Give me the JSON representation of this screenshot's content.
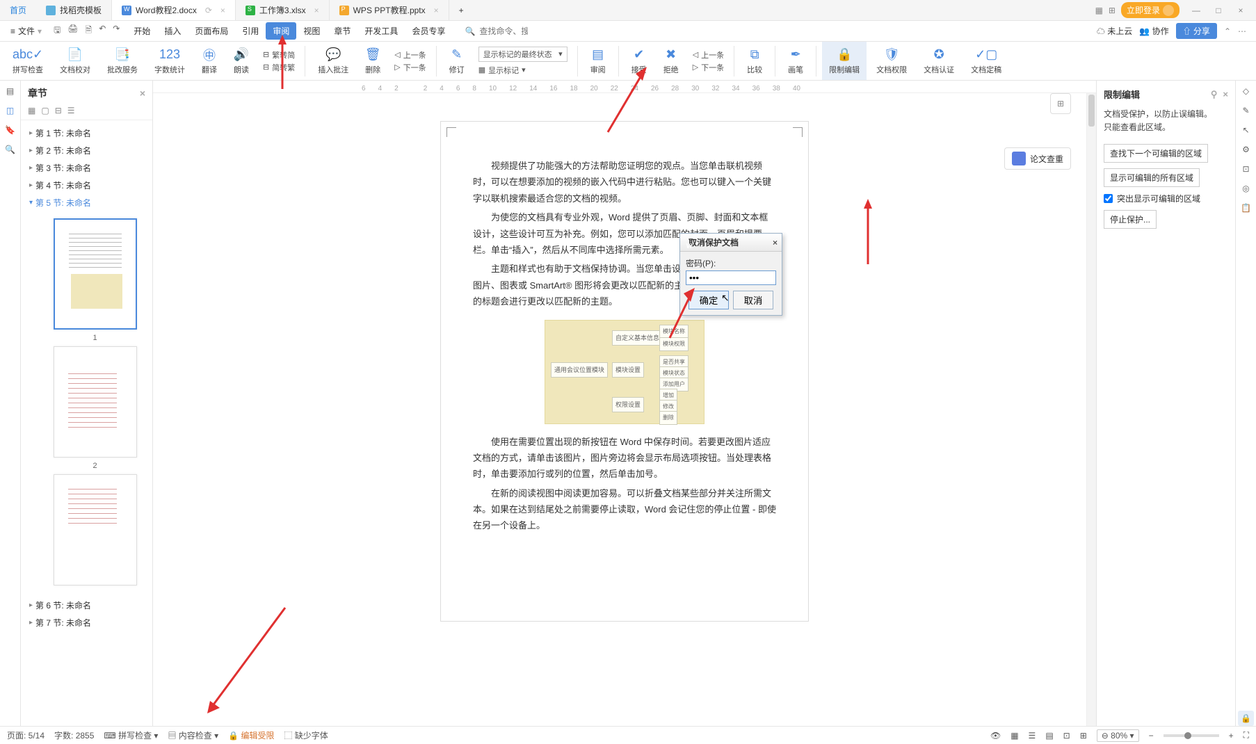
{
  "tabs": {
    "home": "首页",
    "items": [
      {
        "icon": "d",
        "label": "找稻壳模板"
      },
      {
        "icon": "w",
        "label": "Word教程2.docx",
        "active": true
      },
      {
        "icon": "s",
        "label": "工作簿3.xlsx"
      },
      {
        "icon": "p",
        "label": "WPS PPT教程.pptx"
      }
    ],
    "login": "立即登录"
  },
  "menubar": {
    "file": "文件",
    "menus": [
      "开始",
      "插入",
      "页面布局",
      "引用",
      "审阅",
      "视图",
      "章节",
      "开发工具",
      "会员专享"
    ],
    "active": 4,
    "search_placeholder": "查找命令、搜索模板",
    "cloud": "未上云",
    "collab": "协作",
    "share": "分享"
  },
  "ribbon": {
    "items": [
      {
        "l": "拼写检查"
      },
      {
        "l": "文档校对"
      },
      {
        "l": "批改服务"
      },
      {
        "l": "字数统计"
      },
      {
        "l": "翻译"
      },
      {
        "l": "朗读"
      },
      {
        "l": "插入批注"
      },
      {
        "l": "删除"
      },
      {
        "l": "修订"
      },
      {
        "l": "审阅"
      },
      {
        "l": "接受"
      },
      {
        "l": "拒绝"
      },
      {
        "l": "比较"
      },
      {
        "l": "画笔"
      },
      {
        "l": "限制编辑",
        "sel": true
      },
      {
        "l": "文档权限"
      },
      {
        "l": "文档认证"
      },
      {
        "l": "文档定稿"
      }
    ],
    "simp": "繁转简",
    "trad": "简转繁",
    "prev": "上一条",
    "next": "下一条",
    "state_label": "显示标记的最终状态",
    "show_marks": "显示标记",
    "c_prev": "上一条",
    "c_next": "下一条"
  },
  "nav": {
    "title": "章节",
    "sections": [
      "第 1 节: 未命名",
      "第 2 节: 未命名",
      "第 3 节: 未命名",
      "第 4 节: 未命名",
      "第 5 节: 未命名",
      "第 6 节: 未命名",
      "第 7 节: 未命名"
    ],
    "open": 4,
    "page_nums": [
      "1",
      "2"
    ]
  },
  "doc": {
    "essay_btn": "论文查重",
    "p1": "视频提供了功能强大的方法帮助您证明您的观点。当您单击联机视频时，可以在想要添加的视频的嵌入代码中进行粘贴。您也可以键入一个关键字以联机搜索最适合您的文档的视频。",
    "p2": "为使您的文档具有专业外观，Word 提供了页眉、页脚、封面和文本框设计，这些设计可互为补充。例如，您可以添加匹配的封面、页眉和提要栏。单击“插入”，然后从不同库中选择所需元素。",
    "p3": "主题和样式也有助于文档保持协调。当您单击设计并选择新的主题时，图片、图表或 SmartArt® 图形将会更改以匹配新的主题。当应用样式时，您的标题会进行更改以匹配新的主题。",
    "p4": "使用在需要位置出现的新按钮在 Word 中保存时间。若要更改图片适应文档的方式，请单击该图片，图片旁边将会显示布局选项按钮。当处理表格时，单击要添加行或列的位置，然后单击加号。",
    "p5": "在新的阅读视图中阅读更加容易。可以折叠文档某些部分并关注所需文本。如果在达到结尾处之前需要停止读取，Word 会记住您的停止位置 - 即使在另一个设备上。"
  },
  "restrict": {
    "title": "限制编辑",
    "info1": "文档受保护，以防止误编辑。",
    "info2": "只能查看此区域。",
    "btn_find": "查找下一个可编辑的区域",
    "btn_show": "显示可编辑的所有区域",
    "chk": "突出显示可编辑的区域",
    "chk_on": true,
    "btn_stop": "停止保护..."
  },
  "dialog": {
    "title": "取消保护文档",
    "pw_label": "密码(P):",
    "pw_value": "•••",
    "ok": "确定",
    "cancel": "取消"
  },
  "status": {
    "page": "页面: 5/14",
    "words": "字数: 2855",
    "spell": "拼写检查",
    "content": "内容检查",
    "restricted": "编辑受限",
    "missing": "缺少字体",
    "zoom": "80%"
  },
  "ruler": [
    "6",
    "4",
    "2",
    "",
    "2",
    "4",
    "6",
    "8",
    "10",
    "12",
    "14",
    "16",
    "18",
    "20",
    "22",
    "24",
    "26",
    "28",
    "30",
    "32",
    "34",
    "36",
    "38",
    "40"
  ]
}
